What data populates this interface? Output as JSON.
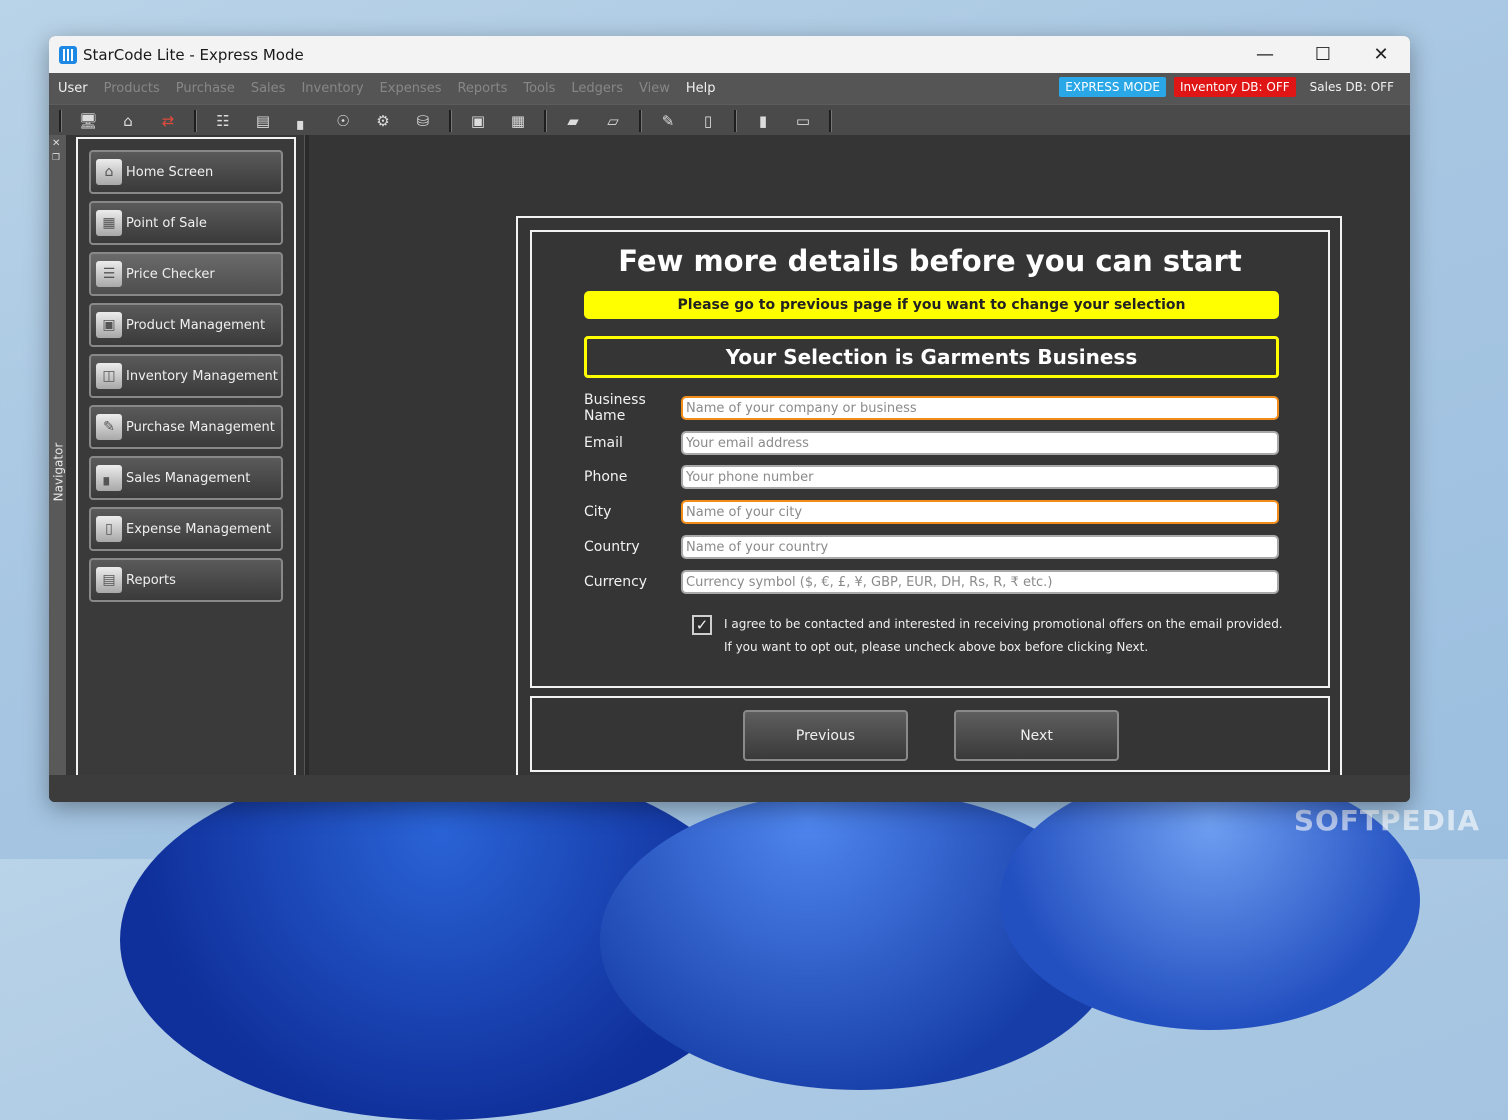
{
  "window": {
    "title": "StarCode Lite - Express Mode",
    "minimize_icon": "minimize-icon",
    "maximize_icon": "maximize-icon",
    "close_icon": "close-icon"
  },
  "menu": {
    "items": [
      "User",
      "Products",
      "Purchase",
      "Sales",
      "Inventory",
      "Expenses",
      "Reports",
      "Tools",
      "Ledgers",
      "View",
      "Help"
    ],
    "active": [
      "User",
      "Help"
    ],
    "badges": {
      "express": "EXPRESS MODE",
      "inventory_db": "Inventory DB: OFF",
      "sales_db": "Sales DB: OFF"
    },
    "colors": {
      "express": "#2aa7e6",
      "inventory_db": "#e01616"
    }
  },
  "toolbar": {
    "icons": [
      "monitor-icon",
      "home-icon",
      "transfer-arrows-icon",
      "hierarchy-icon",
      "document-icon",
      "chart-icon",
      "disc-icon",
      "gear-icon",
      "database-icon",
      "boxes-icon",
      "blocks-icon",
      "open-box-icon",
      "box-icon",
      "invoice-icon",
      "wallet-icon",
      "folder-icon",
      "folder-open-icon"
    ]
  },
  "navigator": {
    "label": "Navigator",
    "items": [
      {
        "label": "Home Screen",
        "icon": "home-icon"
      },
      {
        "label": "Point of Sale",
        "icon": "pos-terminal-icon"
      },
      {
        "label": "Price Checker",
        "icon": "barcode-icon"
      },
      {
        "label": "Product Management",
        "icon": "product-box-icon"
      },
      {
        "label": "Inventory Management",
        "icon": "inventory-boxes-icon"
      },
      {
        "label": "Purchase Management",
        "icon": "purchase-list-icon"
      },
      {
        "label": "Sales Management",
        "icon": "sales-chart-icon"
      },
      {
        "label": "Expense Management",
        "icon": "expense-wallet-icon"
      },
      {
        "label": "Reports",
        "icon": "report-icon"
      }
    ],
    "selected": "Price Checker"
  },
  "form": {
    "heading": "Few more details before you can start",
    "notice": "Please go to previous page if you want to change your selection",
    "selection": "Your Selection is Garments Business",
    "fields": [
      {
        "label": "Business Name",
        "placeholder": "Name of your company or business",
        "value": ""
      },
      {
        "label": "Email",
        "placeholder": "Your email address",
        "value": ""
      },
      {
        "label": "Phone",
        "placeholder": "Your phone number",
        "value": ""
      },
      {
        "label": "City",
        "placeholder": "Name of your city",
        "value": ""
      },
      {
        "label": "Country",
        "placeholder": "Name of your country",
        "value": ""
      },
      {
        "label": "Currency",
        "placeholder": "Currency symbol ($, €, £, ¥, GBP, EUR, DH, Rs, R, ₹ etc.)",
        "value": ""
      }
    ],
    "consent_checked": true,
    "consent_line1": "I agree to be contacted and interested in receiving promotional offers on the email provided.",
    "consent_line2": "If you want to opt out, please uncheck above box before clicking Next.",
    "previous_label": "Previous",
    "next_label": "Next",
    "accent_yellow": "#ffff00",
    "focus_orange": "#f08c1a"
  },
  "watermark": "SOFTPEDIA"
}
